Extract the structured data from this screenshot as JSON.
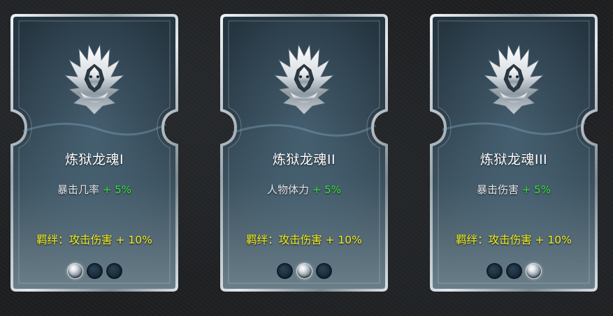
{
  "cards": [
    {
      "title": "炼狱龙魂I",
      "stat_label": "暴击几率",
      "stat_bonus": "+ 5%",
      "bond_text": "羁绊：攻击伤害 + 10%",
      "gem_active_index": 0,
      "emblem_icon": "dragon-crest-icon"
    },
    {
      "title": "炼狱龙魂II",
      "stat_label": "人物体力",
      "stat_bonus": "+ 5%",
      "bond_text": "羁绊：攻击伤害 + 10%",
      "gem_active_index": 1,
      "emblem_icon": "dragon-crest-icon"
    },
    {
      "title": "炼狱龙魂III",
      "stat_label": "暴击伤害",
      "stat_bonus": "+ 5%",
      "bond_text": "羁绊：攻击伤害 + 10%",
      "gem_active_index": 2,
      "emblem_icon": "dragon-crest-icon"
    }
  ],
  "colors": {
    "title": "#ffffff",
    "stat_label": "#e6e8ea",
    "stat_bonus": "#39e43a",
    "bond_text": "#f3ef22",
    "frame_silver": "#c9d2d8",
    "card_fill": "#2a3a47"
  }
}
